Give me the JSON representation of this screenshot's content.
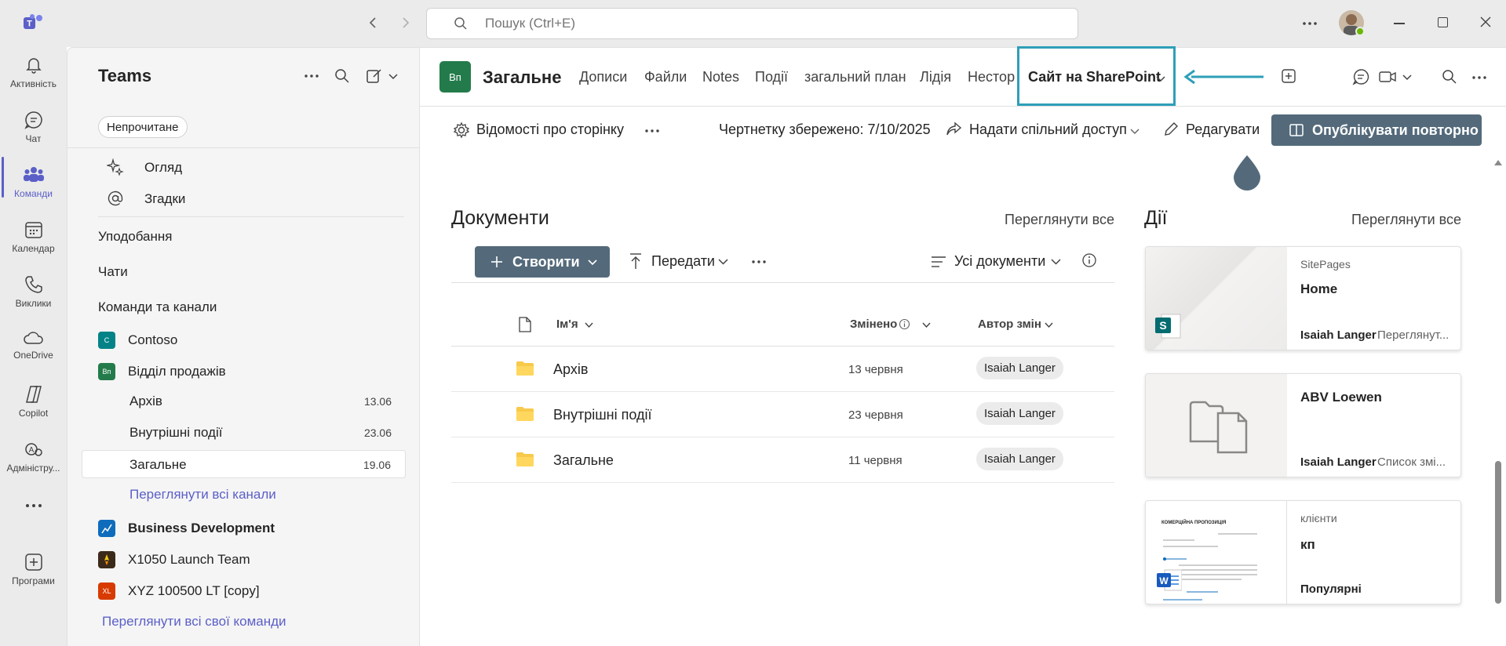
{
  "search": {
    "placeholder": "Пошук (Ctrl+E)"
  },
  "rail": [
    {
      "label": "Активність",
      "icon": "bell-icon"
    },
    {
      "label": "Чат",
      "icon": "chat-icon"
    },
    {
      "label": "Команди",
      "icon": "teams-icon",
      "active": true
    },
    {
      "label": "Календар",
      "icon": "calendar-icon"
    },
    {
      "label": "Виклики",
      "icon": "phone-icon"
    },
    {
      "label": "OneDrive",
      "icon": "cloud-icon"
    },
    {
      "label": "Copilot",
      "icon": "copilot-icon"
    },
    {
      "label": "Адміністру...",
      "icon": "admin-icon"
    },
    {
      "label": "Програми",
      "icon": "apps-icon"
    }
  ],
  "left": {
    "title": "Teams",
    "filter": "Непрочитане",
    "overview": "Огляд",
    "mentions": "Згадки",
    "favorites": "Уподобання",
    "chats": "Чати",
    "teams_channels": "Команди та канали",
    "teams": [
      {
        "name": "Contoso",
        "abbr": "C",
        "color": "#038387"
      },
      {
        "name": "Відділ продажів",
        "abbr": "Вп",
        "color": "#237b4b"
      }
    ],
    "channels": [
      {
        "name": "Архів",
        "date": "13.06"
      },
      {
        "name": "Внутрішні події",
        "date": "23.06"
      },
      {
        "name": "Загальне",
        "date": "19.06"
      }
    ],
    "see_all_channels": "Переглянути всі канали",
    "other_teams": [
      {
        "name": "Business Development",
        "abbr": "",
        "color": "#0f6cbd"
      },
      {
        "name": "X1050 Launch Team",
        "abbr": "",
        "color": "#3b2a1a"
      },
      {
        "name": "XYZ 100500 LT [copy]",
        "abbr": "XL",
        "color": "#d83b01"
      }
    ],
    "see_all_teams": "Переглянути всі свої команди"
  },
  "header": {
    "avatar": "Вп",
    "channel": "Загальне",
    "tabs": [
      "Дописи",
      "Файли",
      "Notes",
      "Події",
      "загальний план",
      "Лідія",
      "Нестор"
    ],
    "active_tab": "Сайт на SharePoint"
  },
  "toolbar": {
    "page_details": "Відомості про сторінку",
    "draft_saved": "Чертнетку збережено: 7/10/2025",
    "share": "Надати спільний доступ",
    "edit": "Редагувати",
    "republish": "Опублікувати повторно"
  },
  "documents": {
    "title": "Документи",
    "see_all": "Переглянути все",
    "create": "Створити",
    "upload": "Передати",
    "view": "Усі документи",
    "columns": {
      "name": "Ім'я",
      "modified": "Змінено",
      "modified_by": "Автор змін"
    },
    "rows": [
      {
        "name": "Архів",
        "modified": "13 червня",
        "by": "Isaiah Langer"
      },
      {
        "name": "Внутрішні події",
        "modified": "23 червня",
        "by": "Isaiah Langer"
      },
      {
        "name": "Загальне",
        "modified": "11 червня",
        "by": "Isaiah Langer"
      }
    ]
  },
  "activity": {
    "title": "Дії",
    "see_all": "Переглянути все",
    "cards": [
      {
        "category": "SitePages",
        "title": "Home",
        "author": "Isaiah Langer",
        "action": "Переглянут..."
      },
      {
        "category": "",
        "title": "ABV Loewen",
        "author": "Isaiah Langer",
        "action": "Список змі..."
      },
      {
        "category": "клієнти",
        "title": "кп",
        "author": "Популярні",
        "action": ""
      }
    ],
    "doc_preview_title": "КОМЕРЦІЙНА ПРОПОЗИЦІЯ"
  }
}
